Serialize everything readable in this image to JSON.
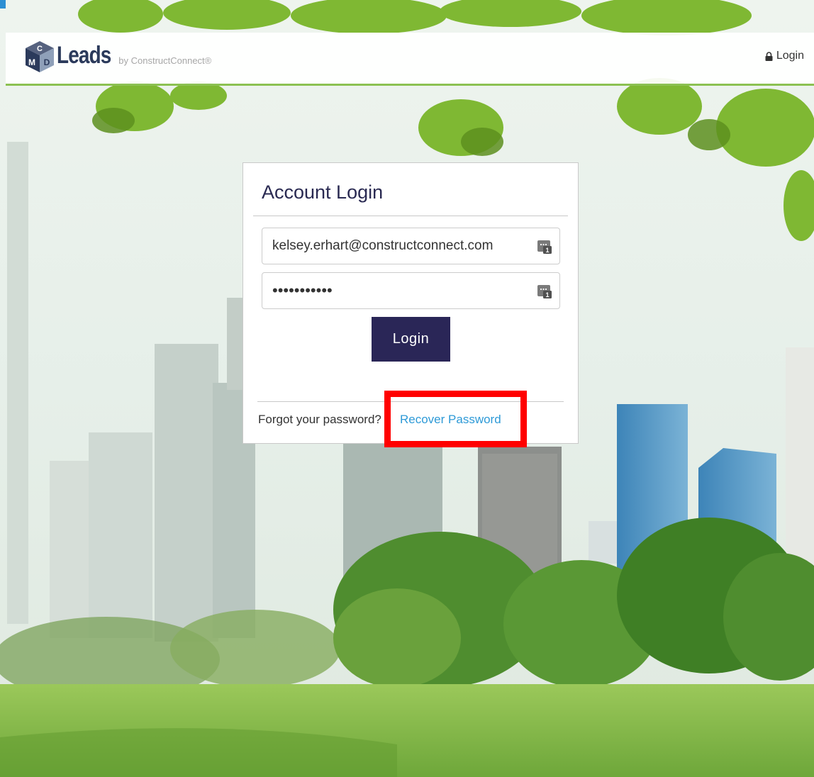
{
  "header": {
    "logo_text": "Leads",
    "logo_byline": "by ConstructConnect®",
    "logo_cube_letters": "CMD",
    "login_link": "Login",
    "accent_color": "#8cc152"
  },
  "login_card": {
    "title": "Account Login",
    "email_value": "kelsey.erhart@constructconnect.com",
    "password_value": "•••••••••••",
    "submit_label": "Login",
    "submit_color": "#2a2657",
    "forgot_text": "Forgot your password?",
    "recover_link": "Recover Password",
    "link_color": "#2e9ad7"
  },
  "annotation": {
    "highlight_color": "#ff0000",
    "highlighted_element": "recover-password-link"
  },
  "icons": [
    "lock-icon",
    "password-manager-key-icon",
    "cmd-cube-logo-icon"
  ]
}
